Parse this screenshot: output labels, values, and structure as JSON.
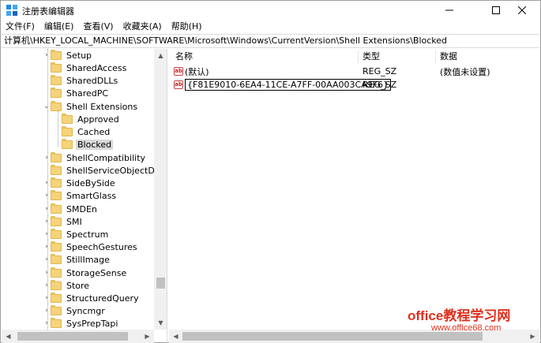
{
  "window": {
    "title": "注册表编辑器",
    "icon": "regedit-icon"
  },
  "menu": [
    {
      "label": "文件(F)"
    },
    {
      "label": "编辑(E)"
    },
    {
      "label": "查看(V)"
    },
    {
      "label": "收藏夹(A)"
    },
    {
      "label": "帮助(H)"
    }
  ],
  "address": {
    "path": "计算机\\HKEY_LOCAL_MACHINE\\SOFTWARE\\Microsoft\\Windows\\CurrentVersion\\Shell Extensions\\Blocked"
  },
  "tree": {
    "items": [
      {
        "label": "Setup",
        "expandable": true
      },
      {
        "label": "SharedAccess",
        "expandable": false
      },
      {
        "label": "SharedDLLs",
        "expandable": false
      },
      {
        "label": "SharedPC",
        "expandable": false
      },
      {
        "label": "Shell Extensions",
        "expandable": true,
        "expanded": true
      },
      {
        "label": "Approved",
        "child": true
      },
      {
        "label": "Cached",
        "child": true
      },
      {
        "label": "Blocked",
        "child": true,
        "selected": true
      },
      {
        "label": "ShellCompatibility",
        "expandable": true
      },
      {
        "label": "ShellServiceObjectDelayLoad",
        "expandable": false
      },
      {
        "label": "SideBySide",
        "expandable": true
      },
      {
        "label": "SmartGlass",
        "expandable": true
      },
      {
        "label": "SMDEn",
        "expandable": true
      },
      {
        "label": "SMI",
        "expandable": true
      },
      {
        "label": "Spectrum",
        "expandable": true
      },
      {
        "label": "SpeechGestures",
        "expandable": true
      },
      {
        "label": "StillImage",
        "expandable": true
      },
      {
        "label": "StorageSense",
        "expandable": true
      },
      {
        "label": "Store",
        "expandable": true
      },
      {
        "label": "StructuredQuery",
        "expandable": true
      },
      {
        "label": "Syncmgr",
        "expandable": true
      },
      {
        "label": "SysPrepTapi",
        "expandable": true
      }
    ]
  },
  "values": {
    "headers": {
      "name": "名称",
      "type": "类型",
      "data": "数据"
    },
    "rows": [
      {
        "name": "(默认)",
        "type": "REG_SZ",
        "data": "(数值未设置)",
        "editing": false
      },
      {
        "name": "{F81E9010-6EA4-11CE-A7FF-00AA003CA9F6}",
        "type": "REG_SZ",
        "data": "",
        "editing": true
      }
    ]
  },
  "watermark": {
    "title": "office教程学习网",
    "url": "www.office68.com"
  },
  "colors": {
    "folder": "#f5d37a",
    "watermark": "#e0301e",
    "selection": "#d9d9d9"
  }
}
